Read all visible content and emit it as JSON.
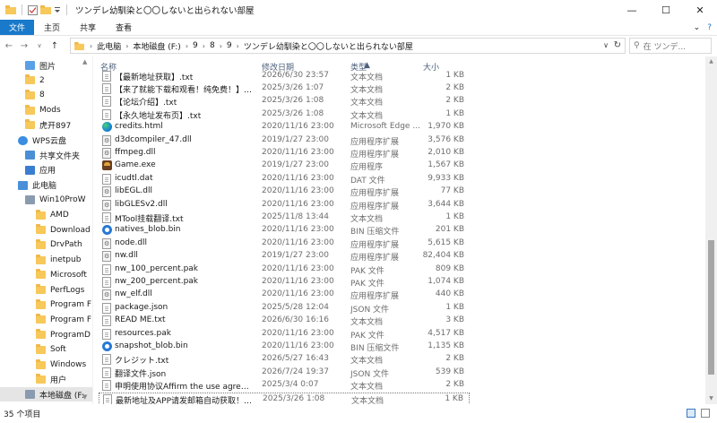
{
  "window": {
    "title": "ツンデレ幼馴染と〇〇しないと出られない部屋",
    "buttons": {
      "minimize": "—",
      "maximize": "☐",
      "close": "✕"
    }
  },
  "ribbon": {
    "tabs": [
      "文件",
      "主页",
      "共享",
      "查看"
    ],
    "chevron": "⌄",
    "help": "?"
  },
  "address": {
    "breadcrumb": [
      "此电脑",
      "本地磁盘 (F:)",
      "9",
      "8",
      "9",
      "ツンデレ幼馴染と〇〇しないと出られない部屋"
    ],
    "search_placeholder": "在 ツンデ..."
  },
  "sidebar": {
    "items": [
      {
        "label": "图片",
        "icon": "pictures-folder-icon",
        "indent": 1
      },
      {
        "label": "2",
        "icon": "folder-icon",
        "indent": 1
      },
      {
        "label": "8",
        "icon": "folder-icon",
        "indent": 1
      },
      {
        "label": "Mods",
        "icon": "folder-icon",
        "indent": 1
      },
      {
        "label": "虎开897",
        "icon": "folder-icon",
        "indent": 1
      },
      {
        "label": "WPS云盘",
        "icon": "cloud-icon",
        "indent": 0
      },
      {
        "label": "共享文件夹",
        "icon": "shared-folder-icon",
        "indent": 1
      },
      {
        "label": "应用",
        "icon": "apps-icon",
        "indent": 1
      },
      {
        "label": "此电脑",
        "icon": "computer-icon",
        "indent": 0
      },
      {
        "label": "Win10ProW",
        "icon": "drive-icon",
        "indent": 1
      },
      {
        "label": "AMD",
        "icon": "folder-icon",
        "indent": 2
      },
      {
        "label": "Download",
        "icon": "folder-icon",
        "indent": 2
      },
      {
        "label": "DrvPath",
        "icon": "folder-icon",
        "indent": 2
      },
      {
        "label": "inetpub",
        "icon": "folder-icon",
        "indent": 2
      },
      {
        "label": "Microsoft",
        "icon": "folder-icon",
        "indent": 2
      },
      {
        "label": "PerfLogs",
        "icon": "folder-icon",
        "indent": 2
      },
      {
        "label": "Program F",
        "icon": "folder-icon",
        "indent": 2
      },
      {
        "label": "Program F",
        "icon": "folder-icon",
        "indent": 2
      },
      {
        "label": "ProgramD",
        "icon": "folder-icon",
        "indent": 2
      },
      {
        "label": "Soft",
        "icon": "folder-icon",
        "indent": 2
      },
      {
        "label": "Windows",
        "icon": "folder-icon",
        "indent": 2
      },
      {
        "label": "用户",
        "icon": "folder-icon",
        "indent": 2
      },
      {
        "label": "本地磁盘 (F:",
        "icon": "drive-icon",
        "indent": 1,
        "selected": true
      }
    ]
  },
  "columns": {
    "name": "名称",
    "date": "修改日期",
    "type": "类型",
    "size": "大小"
  },
  "files": [
    {
      "name": "【最新地址获取】.txt",
      "date": "2026/6/30 23:57",
      "type": "文本文档",
      "size": "1 KB",
      "icon": "doc"
    },
    {
      "name": "【来了就能下载和观看！纯免费！】.txt",
      "date": "2025/3/26 1:07",
      "type": "文本文档",
      "size": "2 KB",
      "icon": "doc"
    },
    {
      "name": "【论坛介绍】.txt",
      "date": "2025/3/26 1:08",
      "type": "文本文档",
      "size": "2 KB",
      "icon": "doc"
    },
    {
      "name": "【永久地址发布页】.txt",
      "date": "2025/3/26 1:08",
      "type": "文本文档",
      "size": "1 KB",
      "icon": "doc"
    },
    {
      "name": "credits.html",
      "date": "2020/11/16 23:00",
      "type": "Microsoft Edge ...",
      "size": "1,970 KB",
      "icon": "edge"
    },
    {
      "name": "d3dcompiler_47.dll",
      "date": "2019/1/27 23:00",
      "type": "应用程序扩展",
      "size": "3,576 KB",
      "icon": "dll"
    },
    {
      "name": "ffmpeg.dll",
      "date": "2020/11/16 23:00",
      "type": "应用程序扩展",
      "size": "2,010 KB",
      "icon": "dll"
    },
    {
      "name": "Game.exe",
      "date": "2019/1/27 23:00",
      "type": "应用程序",
      "size": "1,567 KB",
      "icon": "exe"
    },
    {
      "name": "icudtl.dat",
      "date": "2020/11/16 23:00",
      "type": "DAT 文件",
      "size": "9,933 KB",
      "icon": "doc"
    },
    {
      "name": "libEGL.dll",
      "date": "2020/11/16 23:00",
      "type": "应用程序扩展",
      "size": "77 KB",
      "icon": "dll"
    },
    {
      "name": "libGLESv2.dll",
      "date": "2020/11/16 23:00",
      "type": "应用程序扩展",
      "size": "3,644 KB",
      "icon": "dll"
    },
    {
      "name": "MTool挂载翻译.txt",
      "date": "2025/11/8 13:44",
      "type": "文本文档",
      "size": "1 KB",
      "icon": "doc"
    },
    {
      "name": "natives_blob.bin",
      "date": "2020/11/16 23:00",
      "type": "BIN 压缩文件",
      "size": "201 KB",
      "icon": "blue"
    },
    {
      "name": "node.dll",
      "date": "2020/11/16 23:00",
      "type": "应用程序扩展",
      "size": "5,615 KB",
      "icon": "dll"
    },
    {
      "name": "nw.dll",
      "date": "2019/1/27 23:00",
      "type": "应用程序扩展",
      "size": "82,404 KB",
      "icon": "dll"
    },
    {
      "name": "nw_100_percent.pak",
      "date": "2020/11/16 23:00",
      "type": "PAK 文件",
      "size": "809 KB",
      "icon": "doc"
    },
    {
      "name": "nw_200_percent.pak",
      "date": "2020/11/16 23:00",
      "type": "PAK 文件",
      "size": "1,074 KB",
      "icon": "doc"
    },
    {
      "name": "nw_elf.dll",
      "date": "2020/11/16 23:00",
      "type": "应用程序扩展",
      "size": "440 KB",
      "icon": "dll"
    },
    {
      "name": "package.json",
      "date": "2025/5/28 12:04",
      "type": "JSON 文件",
      "size": "1 KB",
      "icon": "doc"
    },
    {
      "name": "READ ME.txt",
      "date": "2026/6/30 16:16",
      "type": "文本文档",
      "size": "3 KB",
      "icon": "doc"
    },
    {
      "name": "resources.pak",
      "date": "2020/11/16 23:00",
      "type": "PAK 文件",
      "size": "4,517 KB",
      "icon": "doc"
    },
    {
      "name": "snapshot_blob.bin",
      "date": "2020/11/16 23:00",
      "type": "BIN 压缩文件",
      "size": "1,135 KB",
      "icon": "blue"
    },
    {
      "name": "クレジット.txt",
      "date": "2026/5/27 16:43",
      "type": "文本文档",
      "size": "2 KB",
      "icon": "doc"
    },
    {
      "name": "翻译文件.json",
      "date": "2026/7/24 19:37",
      "type": "JSON 文件",
      "size": "539 KB",
      "icon": "doc"
    },
    {
      "name": "申明使用协议Affirm the use agreemen...",
      "date": "2025/3/4 0:07",
      "type": "文本文档",
      "size": "2 KB",
      "icon": "doc"
    },
    {
      "name": "最新地址及APP请发邮箱自动获取！！！...",
      "date": "2025/3/26 1:08",
      "type": "文本文档",
      "size": "1 KB",
      "icon": "doc",
      "focused": true
    }
  ],
  "scroll_position": 0.9,
  "status": {
    "count": "35 个项目"
  }
}
